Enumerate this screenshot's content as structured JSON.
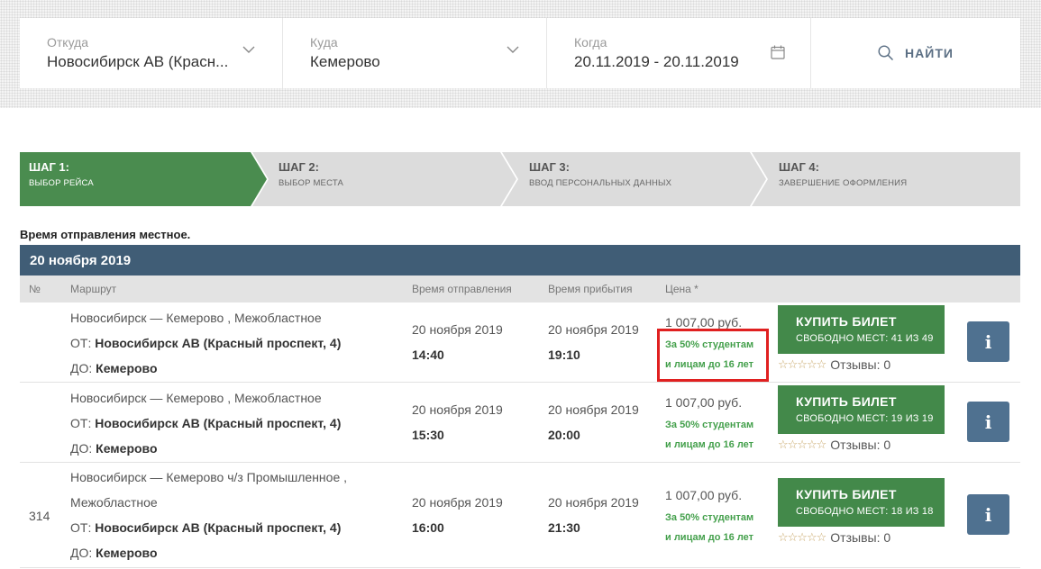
{
  "search": {
    "from": {
      "label": "Откуда",
      "value": "Новосибирск АВ (Красн..."
    },
    "to": {
      "label": "Куда",
      "value": "Кемерово"
    },
    "when": {
      "label": "Когда",
      "value": "20.11.2019 - 20.11.2019"
    },
    "find_label": "НАЙТИ"
  },
  "steps": [
    {
      "title": "ШАГ 1:",
      "subtitle": "ВЫБОР РЕЙСА",
      "active": true
    },
    {
      "title": "ШАГ 2:",
      "subtitle": "ВЫБОР МЕСТА",
      "active": false
    },
    {
      "title": "ШАГ 3:",
      "subtitle": "ВВОД ПЕРСОНАЛЬНЫХ ДАННЫХ",
      "active": false
    },
    {
      "title": "ШАГ 4:",
      "subtitle": "ЗАВЕРШЕНИЕ ОФОРМЛЕНИЯ",
      "active": false
    }
  ],
  "note": "Время отправления местное.",
  "date_header": "20 ноября 2019",
  "columns": {
    "num": "№",
    "route": "Маршрут",
    "departure": "Время отправления",
    "arrival": "Время прибытия",
    "price": "Цена *"
  },
  "common": {
    "from_prefix": "ОТ:",
    "to_prefix": "ДО:",
    "promo_line1": "За 50% студентам",
    "promo_line2": "и лицам до 16 лет",
    "buy_label": "КУПИТЬ БИЛЕТ",
    "reviews_label": "Отзывы: 0",
    "stars": "☆☆☆☆☆",
    "info_icon": "i"
  },
  "trips": [
    {
      "num": "",
      "route_name": "Новосибирск — Кемерово , Межобластное",
      "from_station": "Новосибирск АВ (Красный проспект, 4)",
      "to_station": "Кемерово",
      "dep_date": "20 ноября 2019",
      "dep_time": "14:40",
      "arr_date": "20 ноября 2019",
      "arr_time": "19:10",
      "price": "1 007,00 руб.",
      "seats": "СВОБОДНО МЕСТ: 41 ИЗ 49"
    },
    {
      "num": "",
      "route_name": "Новосибирск — Кемерово , Межобластное",
      "from_station": "Новосибирск АВ (Красный проспект, 4)",
      "to_station": "Кемерово",
      "dep_date": "20 ноября 2019",
      "dep_time": "15:30",
      "arr_date": "20 ноября 2019",
      "arr_time": "20:00",
      "price": "1 007,00 руб.",
      "seats": "СВОБОДНО МЕСТ: 19 ИЗ 19"
    },
    {
      "num": "314",
      "route_name_line1": "Новосибирск — Кемерово ч/з Промышленное ,",
      "route_name_line2": "Межобластное",
      "from_station": "Новосибирск АВ (Красный проспект, 4)",
      "to_station": "Кемерово",
      "dep_date": "20 ноября 2019",
      "dep_time": "16:00",
      "arr_date": "20 ноября 2019",
      "arr_time": "21:30",
      "price": "1 007,00 руб.",
      "seats": "СВОБОДНО МЕСТ: 18 ИЗ 18"
    }
  ],
  "colors": {
    "step_active": "#4a8c4f",
    "step_inactive": "#dcdcdc",
    "header_band": "#405d76",
    "buy_button": "#43894a",
    "info_button": "#4f7190",
    "promo_text": "#44a04c",
    "highlight": "#e02020"
  }
}
